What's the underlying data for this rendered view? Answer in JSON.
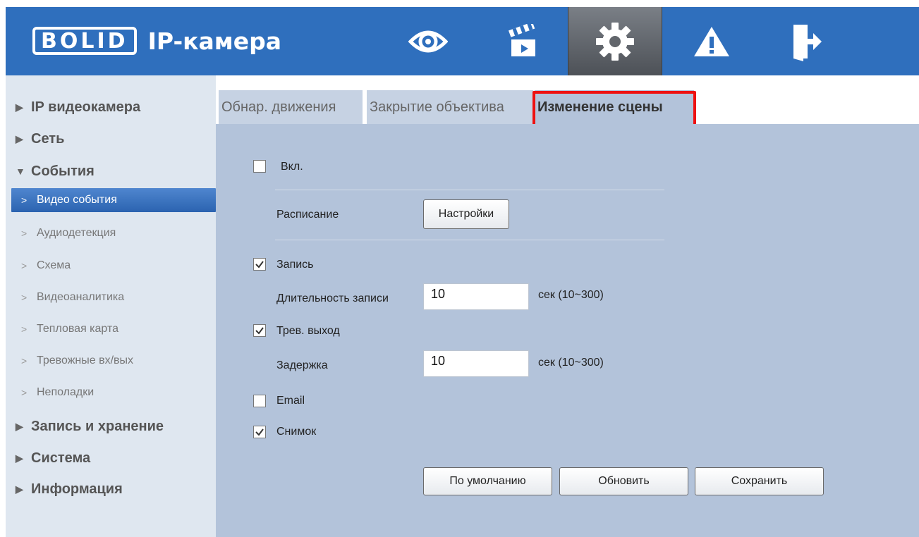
{
  "header": {
    "logo_word": "BOLID",
    "title": "IP-камера",
    "nav": [
      {
        "name": "live-view-eye-icon",
        "active": false
      },
      {
        "name": "playback-clapper-icon",
        "active": false
      },
      {
        "name": "settings-gear-icon",
        "active": true
      },
      {
        "name": "alarm-warning-icon",
        "active": false
      },
      {
        "name": "logout-door-icon",
        "active": false
      }
    ]
  },
  "sidebar": {
    "groups": {
      "ip_camera": "IP видеокамера",
      "network": "Сеть",
      "events": "События",
      "record_storage": "Запись и хранение",
      "system": "Система",
      "info": "Информация"
    },
    "events_items": [
      {
        "label": "Видео события",
        "active": true
      },
      {
        "label": "Аудиодетекция",
        "active": false
      },
      {
        "label": "Схема",
        "active": false
      },
      {
        "label": "Видеоаналитика",
        "active": false
      },
      {
        "label": "Тепловая карта",
        "active": false
      },
      {
        "label": "Тревожные вх/вых",
        "active": false
      },
      {
        "label": "Неполадки",
        "active": false
      }
    ]
  },
  "tabs": [
    {
      "label": "Обнар. движения",
      "active": false
    },
    {
      "label": "Закрытие объектива",
      "active": false
    },
    {
      "label": "Изменение сцены",
      "active": true
    }
  ],
  "form": {
    "enable": {
      "label": "Вкл.",
      "checked": false
    },
    "schedule": {
      "label": "Расписание",
      "button": "Настройки"
    },
    "record": {
      "label": "Запись",
      "checked": true
    },
    "record_duration": {
      "label": "Длительность записи",
      "value": "10",
      "unit": "сек (10~300)"
    },
    "alarm_out": {
      "label": "Трев. выход",
      "checked": true
    },
    "delay": {
      "label": "Задержка",
      "value": "10",
      "unit": "сек (10~300)"
    },
    "email": {
      "label": "Email",
      "checked": false
    },
    "snapshot": {
      "label": "Снимок",
      "checked": true
    }
  },
  "buttons": {
    "default": "По умолчанию",
    "refresh": "Обновить",
    "save": "Сохранить"
  },
  "colors": {
    "header_bg": "#2f6fbd",
    "sidebar_bg": "#dfe7f0",
    "content_bg": "#b3c3da",
    "highlight": "#ee1111"
  }
}
